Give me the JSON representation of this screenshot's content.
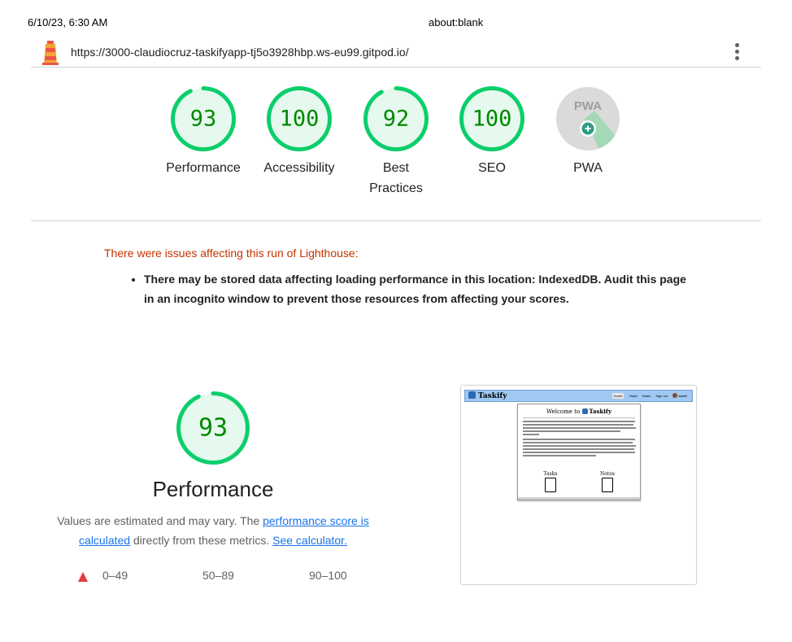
{
  "print_header": {
    "date": "6/10/23, 6:30 AM",
    "title": "about:blank"
  },
  "topbar": {
    "url": "https://3000-claudiocruz-taskifyapp-tj5o3928hbp.ws-eu99.gitpod.io/",
    "logo_icon": "lighthouse-icon",
    "menu_icon": "kebab-menu-icon"
  },
  "colors": {
    "pass": "#0cce6b",
    "pass_fill": "#e6f9ee",
    "pass_text": "#008800",
    "fail": "#e53935",
    "warning_text": "#c33300",
    "link": "#1a73e8"
  },
  "scores": [
    {
      "id": "performance",
      "label": "Performance",
      "value": "93",
      "fraction": 0.93
    },
    {
      "id": "accessibility",
      "label": "Accessibility",
      "value": "100",
      "fraction": 1.0
    },
    {
      "id": "best-practices",
      "label": "Best Practices",
      "value": "92",
      "fraction": 0.92
    },
    {
      "id": "seo",
      "label": "SEO",
      "value": "100",
      "fraction": 1.0
    }
  ],
  "pwa": {
    "label": "PWA",
    "badge_text": "PWA",
    "badge_icon": "plus-icon"
  },
  "warnings": {
    "title": "There were issues affecting this run of Lighthouse:",
    "items": [
      "There may be stored data affecting loading performance in this location: IndexedDB. Audit this page in an incognito window to prevent those resources from affecting your scores."
    ]
  },
  "performance": {
    "value": "93",
    "fraction": 0.93,
    "title": "Performance",
    "desc_before": "Values are estimated and may vary. The ",
    "link_score": "performance score is calculated",
    "desc_middle": " directly from these metrics. ",
    "link_calc": "See calculator."
  },
  "legend": {
    "fail": "0–49",
    "average": "50–89",
    "pass": "90–100"
  },
  "screenshot": {
    "brand": "Taskify",
    "nav": [
      "Home",
      "Tasks",
      "Notes",
      "Sign out",
      "Isabel"
    ],
    "welcome": "Welcome to",
    "welcome_brand": "Taskify",
    "tiles": [
      "Tasks",
      "Notes"
    ]
  }
}
